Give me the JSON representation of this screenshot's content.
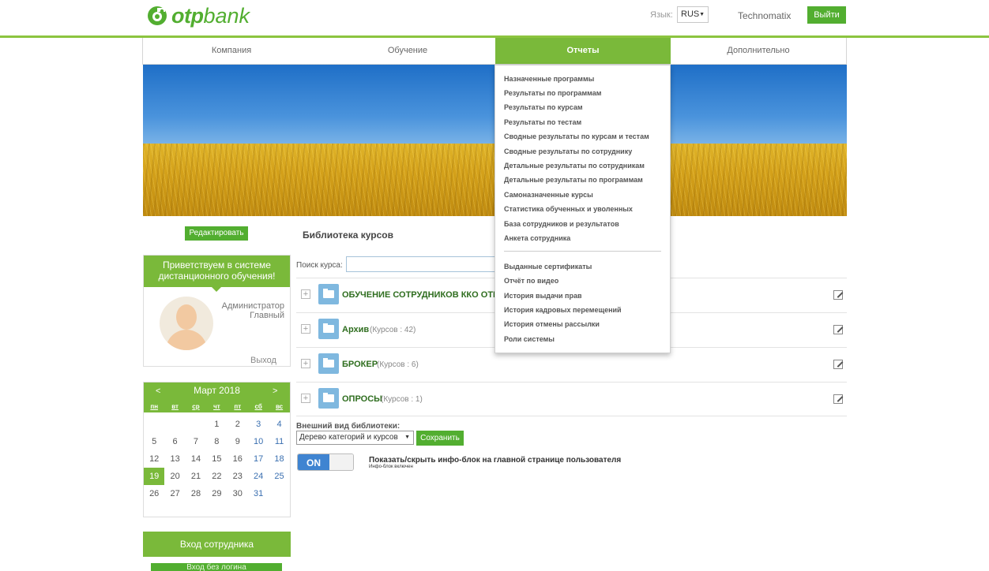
{
  "brand": {
    "logo_otp": "otp",
    "logo_bank": "bank",
    "color": "#52ae30"
  },
  "header": {
    "lang_label": "Язык:",
    "lang_value": "RUS",
    "user": "Technomatix",
    "logout": "Выйти"
  },
  "nav": {
    "items": [
      {
        "label": "Компания"
      },
      {
        "label": "Обучение"
      },
      {
        "label": "Отчеты",
        "active": true
      },
      {
        "label": "Дополнительно"
      }
    ]
  },
  "reports_menu": {
    "group1": [
      "Назначенные программы",
      "Результаты по программам",
      "Результаты по курсам",
      "Результаты по тестам",
      "Сводные результаты по курсам и тестам",
      "Сводные результаты по сотруднику",
      "Детальные результаты по сотрудникам",
      "Детальные результаты по программам",
      "Самоназначенные курсы",
      "Статистика обученных и уволенных",
      "База сотрудников и результатов",
      "Анкета сотрудника"
    ],
    "group2": [
      "Выданные сертификаты",
      "Отчёт по видео",
      "История выдачи прав",
      "История кадровых перемещений",
      "История отмены рассылки",
      "Роли системы"
    ]
  },
  "left": {
    "edit_button": "Редактировать",
    "welcome_line1": "Приветствуем в системе",
    "welcome_line2": "дистанционного обучения!",
    "role_line1": "Администратор",
    "role_line2": "Главный",
    "exit": "Выход",
    "employee_login": "Вход сотрудника",
    "employee_login_btn": "Вход без логина"
  },
  "calendar": {
    "prev": "<",
    "next": ">",
    "title": "Март 2018",
    "dows": [
      "пн",
      "вт",
      "ср",
      "чт",
      "пт",
      "сб",
      "вс"
    ],
    "weeks": [
      [
        "",
        "",
        "",
        "1",
        "2",
        "3",
        "4"
      ],
      [
        "5",
        "6",
        "7",
        "8",
        "9",
        "10",
        "11"
      ],
      [
        "12",
        "13",
        "14",
        "15",
        "16",
        "17",
        "18"
      ],
      [
        "19",
        "20",
        "21",
        "22",
        "23",
        "24",
        "25"
      ],
      [
        "26",
        "27",
        "28",
        "29",
        "30",
        "31",
        ""
      ]
    ],
    "today": "19"
  },
  "library": {
    "title": "Библиотека курсов",
    "search_label": "Поиск курса:",
    "search_value": "",
    "rows": [
      {
        "name": "ОБУЧЕНИЕ СОТРУДНИКОВ ККО ОТР Ва",
        "count": ""
      },
      {
        "name": "Архив",
        "count": "(Курсов : 42)"
      },
      {
        "name": "БРОКЕР",
        "count": "(Курсов : 6)"
      },
      {
        "name": "ОПРОСЫ",
        "count": "(Курсов : 1)"
      }
    ],
    "view_label": "Внешний вид библиотеки:",
    "view_value": "Дерево категорий и курсов",
    "save": "Сохранить",
    "toggle_on": "ON",
    "toggle_title": "Показать/скрыть инфо-блок на главной странице пользователя",
    "toggle_sub": "Инфо-блок включен"
  }
}
